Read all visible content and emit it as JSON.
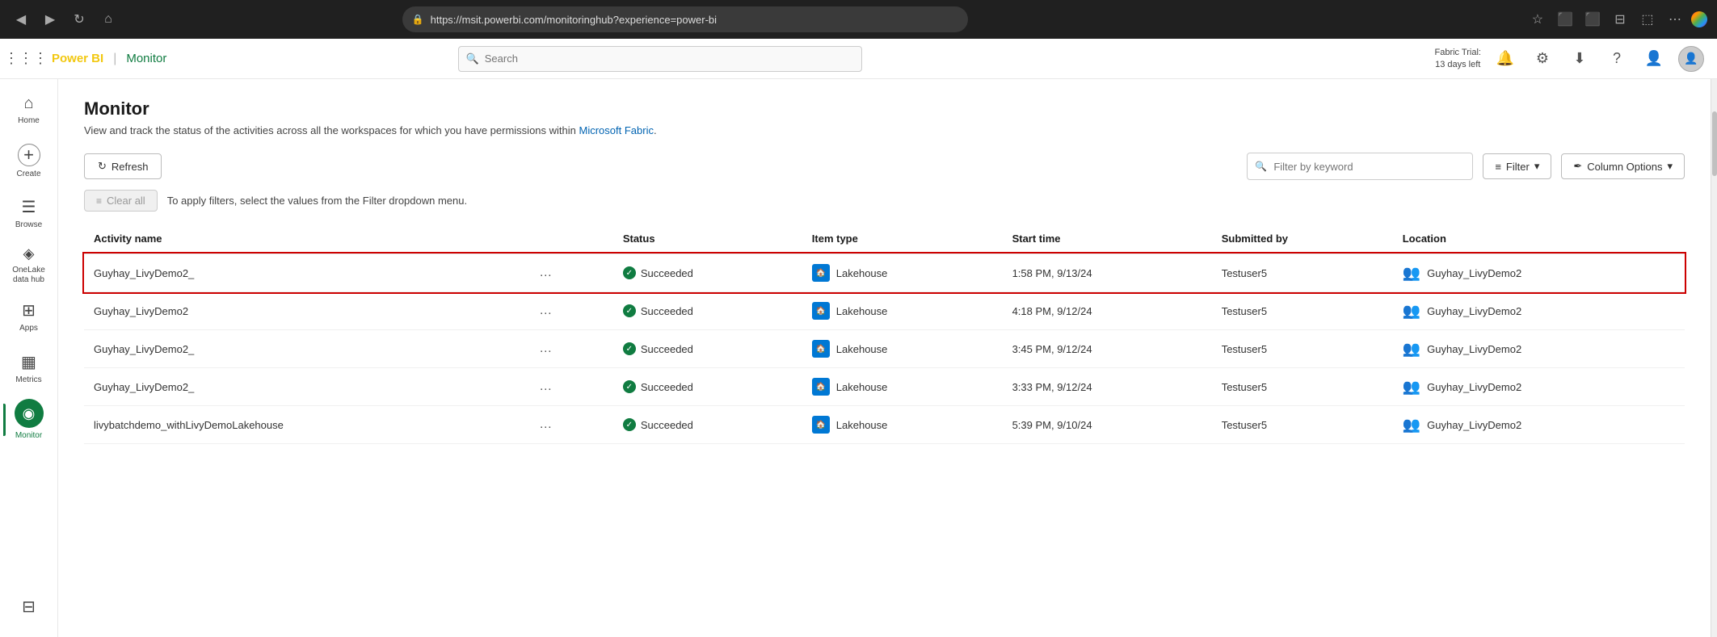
{
  "browser": {
    "url": "https://msit.powerbi.com/monitoringhub?experience=power-bi",
    "nav_back": "◀",
    "nav_forward": "▶",
    "nav_refresh": "↻",
    "nav_home": "⌂"
  },
  "header": {
    "brand_powerbi": "Power BI",
    "brand_section": "Monitor",
    "search_placeholder": "Search",
    "fabric_trial_line1": "Fabric Trial:",
    "fabric_trial_line2": "13 days left"
  },
  "sidebar": {
    "items": [
      {
        "id": "home",
        "label": "Home",
        "icon": "⌂"
      },
      {
        "id": "create",
        "label": "Create",
        "icon": "+"
      },
      {
        "id": "browse",
        "label": "Browse",
        "icon": "☰"
      },
      {
        "id": "onelake",
        "label": "OneLake\ndata hub",
        "icon": "◈"
      },
      {
        "id": "apps",
        "label": "Apps",
        "icon": "⊞"
      },
      {
        "id": "metrics",
        "label": "Metrics",
        "icon": "▦"
      },
      {
        "id": "monitor",
        "label": "Monitor",
        "icon": "◉"
      },
      {
        "id": "workspaces",
        "label": "",
        "icon": "⊟"
      }
    ]
  },
  "page": {
    "title": "Monitor",
    "subtitle": "View and track the status of the activities across all the workspaces for which you have permissions within Microsoft Fabric.",
    "subtitle_link": "Microsoft Fabric"
  },
  "toolbar": {
    "refresh_label": "Refresh",
    "filter_label": "Filter",
    "column_options_label": "Column Options",
    "filter_placeholder": "Filter by keyword"
  },
  "clear_bar": {
    "clear_all_label": "Clear all",
    "hint_text": "To apply filters, select the values from the Filter dropdown menu."
  },
  "table": {
    "columns": [
      "Activity name",
      "",
      "Status",
      "Item type",
      "Start time",
      "Submitted by",
      "Location"
    ],
    "rows": [
      {
        "activity_name": "Guyhay_LivyDemo2_",
        "status": "Succeeded",
        "item_type": "Lakehouse",
        "start_time": "1:58 PM, 9/13/24",
        "submitted_by": "Testuser5",
        "location": "Guyhay_LivyDemo2",
        "selected": true
      },
      {
        "activity_name": "Guyhay_LivyDemo2",
        "status": "Succeeded",
        "item_type": "Lakehouse",
        "start_time": "4:18 PM, 9/12/24",
        "submitted_by": "Testuser5",
        "location": "Guyhay_LivyDemo2",
        "selected": false
      },
      {
        "activity_name": "Guyhay_LivyDemo2_",
        "status": "Succeeded",
        "item_type": "Lakehouse",
        "start_time": "3:45 PM, 9/12/24",
        "submitted_by": "Testuser5",
        "location": "Guyhay_LivyDemo2",
        "selected": false
      },
      {
        "activity_name": "Guyhay_LivyDemo2_",
        "status": "Succeeded",
        "item_type": "Lakehouse",
        "start_time": "3:33 PM, 9/12/24",
        "submitted_by": "Testuser5",
        "location": "Guyhay_LivyDemo2",
        "selected": false
      },
      {
        "activity_name": "livybatchdemo_withLivyDemoLakehouse",
        "status": "Succeeded",
        "item_type": "Lakehouse",
        "start_time": "5:39 PM, 9/10/24",
        "submitted_by": "Testuser5",
        "location": "Guyhay_LivyDemo2",
        "selected": false
      }
    ]
  }
}
